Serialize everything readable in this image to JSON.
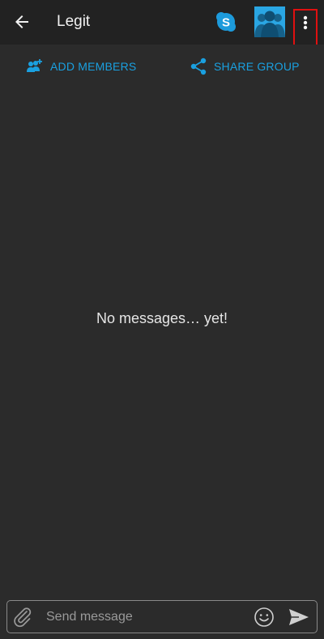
{
  "header": {
    "title": "Legit",
    "skype_logo_letter": "S"
  },
  "actions": {
    "add_members_label": "ADD MEMBERS",
    "share_group_label": "SHARE GROUP"
  },
  "main": {
    "empty_state_text": "No messages… yet!"
  },
  "composer": {
    "placeholder": "Send message",
    "value": ""
  },
  "icons": {
    "back": "arrow-back-icon",
    "skype": "skype-icon",
    "group_avatar": "group-avatar-icon",
    "more": "more-vertical-icon",
    "add_members": "add-person-icon",
    "share": "share-icon",
    "attach": "paperclip-icon",
    "emoji": "emoji-icon",
    "send": "send-icon"
  },
  "colors": {
    "accent": "#1aa0e0",
    "skype_blue": "#1d9bdc",
    "avatar_bg": "#2aa6e3",
    "highlight_box": "#e01010",
    "background": "#2b2b2b",
    "topbar": "#222222"
  }
}
